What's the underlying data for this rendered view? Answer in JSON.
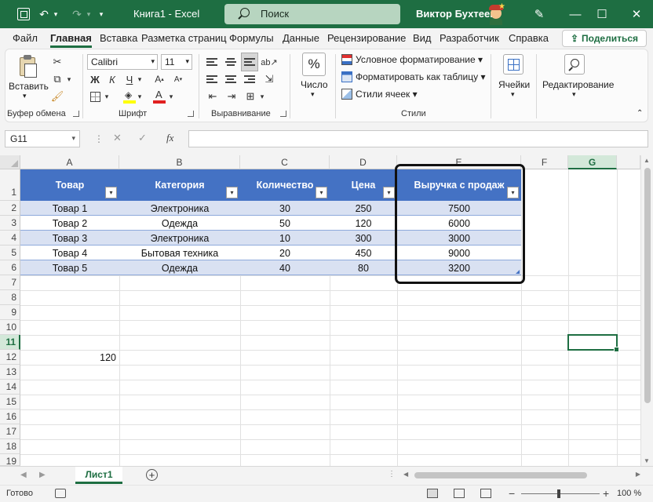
{
  "titlebar": {
    "doc_title": "Книга1 - Excel",
    "search_label": "Поиск",
    "user_name": "Виктор Бухтеев",
    "brand_color": "#1e6e42"
  },
  "ribbon_tabs": [
    "Файл",
    "Главная",
    "Вставка",
    "Разметка страниц",
    "Формулы",
    "Данные",
    "Рецензирование",
    "Вид",
    "Разработчик",
    "Справка"
  ],
  "share_label": "Поделиться",
  "ribbon": {
    "clipboard": {
      "paste_label": "Вставить",
      "group_label": "Буфер обмена"
    },
    "font": {
      "font_name": "Calibri",
      "font_size": "11",
      "bold": "Ж",
      "italic": "К",
      "underline": "Ч",
      "group_label": "Шрифт"
    },
    "alignment": {
      "group_label": "Выравнивание"
    },
    "number": {
      "label": "Число",
      "symbol": "%"
    },
    "styles": {
      "conditional": "Условное форматирование",
      "format_table": "Форматировать как таблицу",
      "cell_styles": "Стили ячеек",
      "group_label": "Стили"
    },
    "cells": {
      "label": "Ячейки"
    },
    "editing": {
      "label": "Редактирование"
    }
  },
  "formula_bar": {
    "name_box": "G11",
    "fx": "fx",
    "formula": ""
  },
  "grid": {
    "columns": [
      "A",
      "B",
      "C",
      "D",
      "E",
      "F",
      "G"
    ],
    "rows": [
      "1",
      "2",
      "3",
      "4",
      "5",
      "6",
      "7",
      "8",
      "9",
      "10",
      "11",
      "12",
      "13",
      "14",
      "15",
      "16",
      "17",
      "18",
      "19"
    ],
    "table": {
      "headers": [
        "Товар",
        "Категория",
        "Количество",
        "Цена",
        "Выручка с продаж"
      ],
      "rows": [
        [
          "Товар 1",
          "Электроника",
          "30",
          "250",
          "7500"
        ],
        [
          "Товар 2",
          "Одежда",
          "50",
          "120",
          "6000"
        ],
        [
          "Товар 3",
          "Электроника",
          "10",
          "300",
          "3000"
        ],
        [
          "Товар 4",
          "Бытовая техника",
          "20",
          "450",
          "9000"
        ],
        [
          "Товар 5",
          "Одежда",
          "40",
          "80",
          "3200"
        ]
      ],
      "header_color": "#4472c4",
      "band_color": "#d9e1f2"
    },
    "cell_a12": "120",
    "selected_cell": "G11"
  },
  "sheets": {
    "active": "Лист1"
  },
  "status": {
    "ready": "Готово",
    "zoom": "100 %"
  }
}
